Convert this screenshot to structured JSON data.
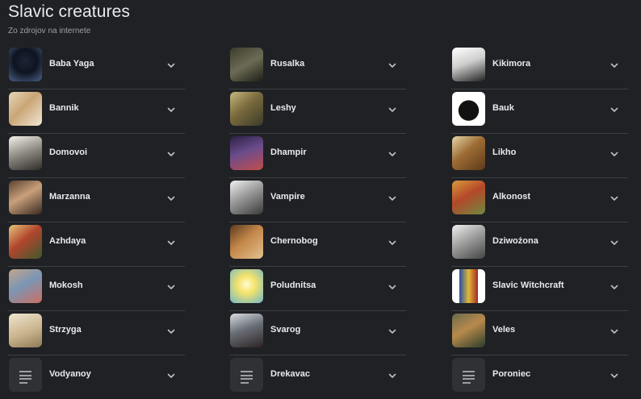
{
  "header": {
    "title": "Slavic creatures",
    "subtitle": "Zo zdrojov na internete"
  },
  "colors": {
    "background": "#202124",
    "text": "#e8eaed",
    "muted": "#9aa0a6",
    "divider": "#3c4043"
  },
  "columns": [
    {
      "items": [
        {
          "label": "Baba Yaga",
          "thumb": "image"
        },
        {
          "label": "Bannik",
          "thumb": "image"
        },
        {
          "label": "Domovoi",
          "thumb": "image"
        },
        {
          "label": "Marzanna",
          "thumb": "image"
        },
        {
          "label": "Azhdaya",
          "thumb": "image"
        },
        {
          "label": "Mokosh",
          "thumb": "image"
        },
        {
          "label": "Strzyga",
          "thumb": "image"
        },
        {
          "label": "Vodyanoy",
          "thumb": "document-icon"
        }
      ]
    },
    {
      "items": [
        {
          "label": "Rusalka",
          "thumb": "image"
        },
        {
          "label": "Leshy",
          "thumb": "image"
        },
        {
          "label": "Dhampir",
          "thumb": "image"
        },
        {
          "label": "Vampire",
          "thumb": "image"
        },
        {
          "label": "Chernobog",
          "thumb": "image"
        },
        {
          "label": "Poludnitsa",
          "thumb": "image"
        },
        {
          "label": "Svarog",
          "thumb": "image"
        },
        {
          "label": "Drekavac",
          "thumb": "document-icon"
        }
      ]
    },
    {
      "items": [
        {
          "label": "Kikimora",
          "thumb": "image"
        },
        {
          "label": "Bauk",
          "thumb": "image"
        },
        {
          "label": "Likho",
          "thumb": "image"
        },
        {
          "label": "Alkonost",
          "thumb": "image"
        },
        {
          "label": "Dziwożona",
          "thumb": "image"
        },
        {
          "label": "Slavic Witchcraft",
          "thumb": "image"
        },
        {
          "label": "Veles",
          "thumb": "image"
        },
        {
          "label": "Poroniec",
          "thumb": "document-icon"
        }
      ]
    }
  ]
}
